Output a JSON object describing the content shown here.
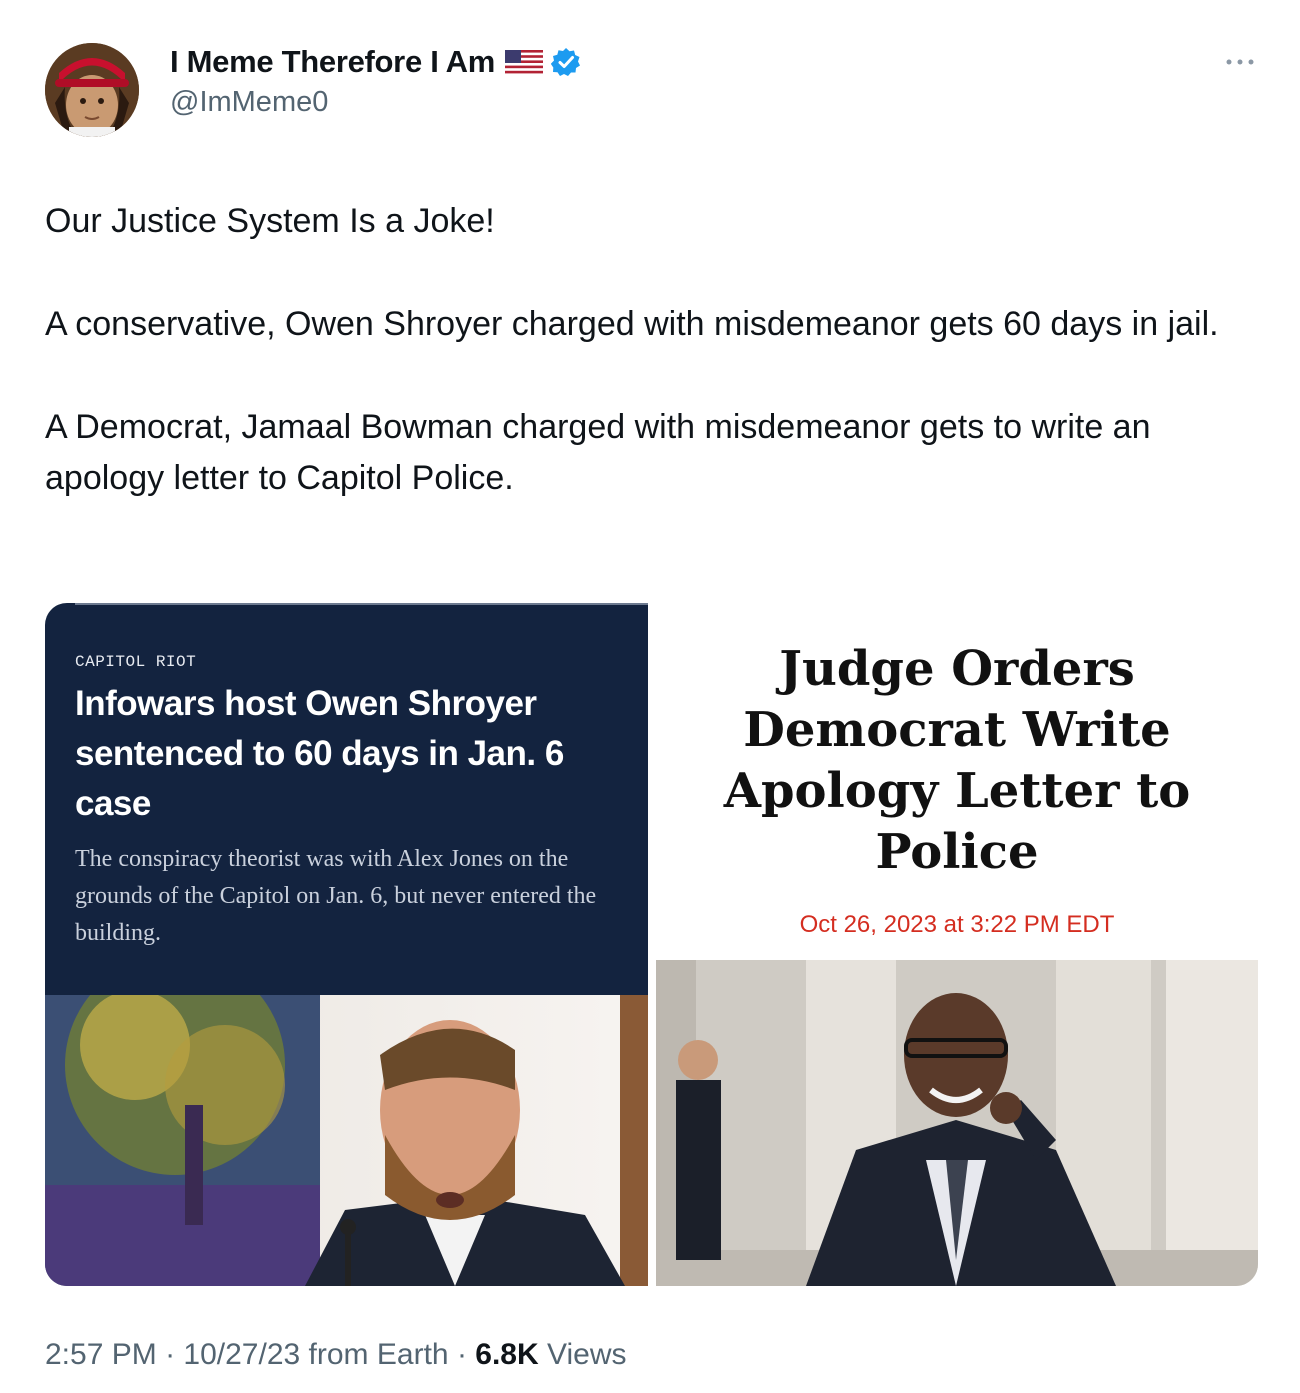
{
  "author": {
    "display_name": "I Meme Therefore I Am",
    "handle": "@ImMeme0",
    "avatar_icon": "avatar-icon",
    "flag_icon": "us-flag-icon",
    "verified_icon": "verified-badge-icon"
  },
  "more_icon": "more-options-icon",
  "tweet": {
    "paragraphs": [
      "Our Justice System Is a Joke!",
      "A conservative, Owen Shroyer charged with misdemeanor gets 60 days in jail.",
      "A Democrat, Jamaal Bowman charged with misdemeanor gets to write an apology letter to Capitol Police."
    ]
  },
  "media": {
    "left": {
      "kicker": "CAPITOL RIOT",
      "headline": "Infowars host Owen Shroyer sentenced to 60 days in Jan. 6 case",
      "dek": "The conspiracy theorist was with Alex Jones on the grounds of the Capitol on Jan. 6, but never entered the building."
    },
    "right": {
      "headline": "Judge Orders Democrat Write Apology Letter to Police",
      "dateline": "Oct 26, 2023 at 3:22 PM EDT"
    }
  },
  "footer": {
    "time": "2:57 PM",
    "date": "10/27/23",
    "source": "from Earth",
    "separator": "·",
    "views_count": "6.8K",
    "views_label": "Views"
  },
  "colors": {
    "text_primary": "#0f1419",
    "text_secondary": "#536471",
    "verified_blue": "#1d9bf0",
    "article_navy": "#13233f",
    "dateline_red": "#d42d20"
  }
}
